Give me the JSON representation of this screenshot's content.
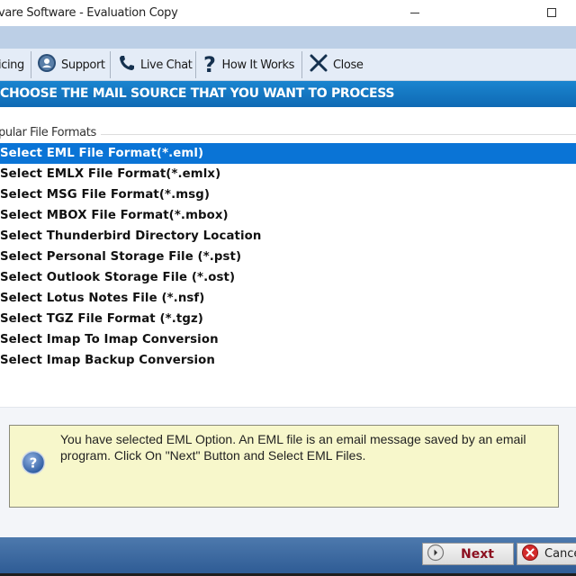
{
  "window": {
    "title": "vare Software - Evaluation Copy"
  },
  "toolbar": {
    "items": [
      {
        "label": "icing",
        "icon": "pricing-icon"
      },
      {
        "label": "Support",
        "icon": "support-icon"
      },
      {
        "label": "Live Chat",
        "icon": "phone-icon"
      },
      {
        "label": "How It Works",
        "icon": "question-icon"
      },
      {
        "label": "Close",
        "icon": "close-icon"
      }
    ]
  },
  "header": {
    "title": "CHOOSE THE MAIL SOURCE THAT YOU WANT TO PROCESS"
  },
  "group": {
    "label": "pular File Formats"
  },
  "list": {
    "selected_index": 0,
    "items": [
      "Select EML File Format(*.eml)",
      "Select EMLX File Format(*.emlx)",
      "Select MSG File Format(*.msg)",
      "Select MBOX File Format(*.mbox)",
      "Select Thunderbird Directory Location",
      "Select Personal Storage File (*.pst)",
      "Select Outlook Storage File (*.ost)",
      "Select Lotus Notes File (*.nsf)",
      "Select TGZ File Format (*.tgz)",
      "Select Imap To Imap Conversion",
      "Select Imap Backup Conversion"
    ]
  },
  "info": {
    "text": "You have selected EML Option. An EML file is an email message saved by an email program. Click On \"Next\" Button and Select EML Files."
  },
  "footer": {
    "next_label": "Next",
    "cancel_label": "Cancel"
  },
  "colors": {
    "header_blue": "#1a84cf",
    "selection_blue": "#0a74d6",
    "info_bg": "#f7f7cb",
    "next_text": "#8c1020"
  }
}
